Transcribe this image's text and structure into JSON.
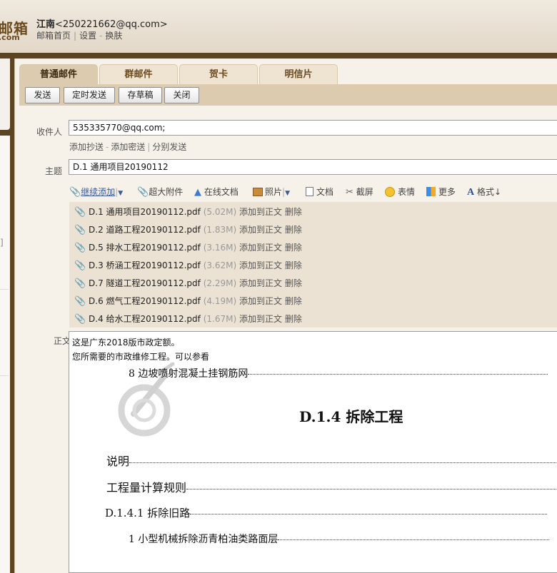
{
  "header": {
    "logo_text": "邮箱",
    "logo_domain": ".com",
    "user_name": "江南",
    "user_email": "<250221662@qq.com>",
    "links": [
      "邮箱首页",
      "设置",
      "换肤"
    ]
  },
  "tabs": [
    "普通邮件",
    "群邮件",
    "贺卡",
    "明信片"
  ],
  "toolbar": {
    "send": "发送",
    "timed_send": "定时发送",
    "save_draft": "存草稿",
    "close": "关闭"
  },
  "form": {
    "recipient_label": "收件人",
    "recipient_value": "535335770@qq.com;",
    "add_cc": "添加抄送",
    "add_bcc": "添加密送",
    "separate_send": "分别发送",
    "subject_label": "主题",
    "subject_value": "D.1 通用项目20190112",
    "body_label": "正文"
  },
  "attach_toolbar": {
    "continue_add": "继续添加",
    "large_attach": "超大附件",
    "online_doc": "在线文档",
    "photo": "照片",
    "doc": "文档",
    "screenshot": "截屏",
    "emoji": "表情",
    "more": "更多",
    "format": "格式↓"
  },
  "attachments": [
    {
      "name": "D.1 通用项目20190112.pdf",
      "size": "(5.02M)"
    },
    {
      "name": "D.2 道路工程20190112.pdf",
      "size": "(1.83M)"
    },
    {
      "name": "D.5 排水工程20190112.pdf",
      "size": "(3.16M)"
    },
    {
      "name": "D.3 桥涵工程20190112.pdf",
      "size": "(3.62M)"
    },
    {
      "name": "D.7 隧道工程20190112.pdf",
      "size": "(2.29M)"
    },
    {
      "name": "D.6 燃气工程20190112.pdf",
      "size": "(4.19M)"
    },
    {
      "name": "D.4 给水工程20190112.pdf",
      "size": "(1.67M)"
    }
  ],
  "attachment_actions": {
    "add_to_body": "添加到正文",
    "delete": "删除"
  },
  "body": {
    "line1": "这是广东2018版市政定额。",
    "line2": "您所需要的市政维修工程。可以参看",
    "toc1": "8 边坡喷射混凝土挂钢筋网",
    "heading": "D.1.4 拆除工程",
    "toc2": "说明",
    "toc3": "工程量计算规则",
    "toc4": "D.1.4.1 拆除旧路",
    "toc5": "1 小型机械拆除沥青柏油类路面层"
  }
}
